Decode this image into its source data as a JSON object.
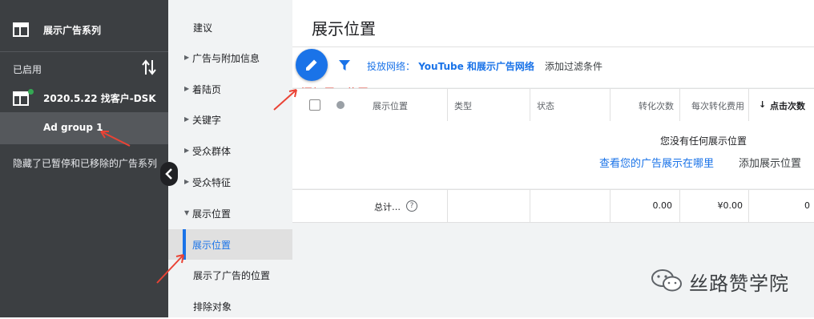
{
  "sidebar": {
    "campaign_types_label": "展示广告系列",
    "enabled_label": "已启用",
    "campaign_name": "2020.5.22 找客户-DSK",
    "ad_group_name": "Ad group 1",
    "hidden_note": "隐藏了已暂停和已移除的广告系列"
  },
  "nav": {
    "items": [
      {
        "label": "建议",
        "expandable": false
      },
      {
        "label": "广告与附加信息",
        "expandable": true
      },
      {
        "label": "着陆页",
        "expandable": true
      },
      {
        "label": "关键字",
        "expandable": true
      },
      {
        "label": "受众群体",
        "expandable": true
      },
      {
        "label": "受众特征",
        "expandable": true
      },
      {
        "label": "展示位置",
        "expandable": true,
        "expanded": true
      },
      {
        "label": "展示位置",
        "sub": true,
        "active": true
      },
      {
        "label": "展示了广告的位置",
        "sub": true
      },
      {
        "label": "排除对象",
        "sub": true
      }
    ]
  },
  "main": {
    "page_title": "展示位置",
    "toolbar": {
      "network_filter_key": "投放网络：",
      "network_filter_value": "YouTube 和展示广告网络",
      "add_filter": "添加过滤条件",
      "add_placement_annotation": "添加展示位置"
    },
    "table": {
      "columns": [
        "展示位置",
        "类型",
        "状态",
        "转化次数",
        "每次转化费用",
        "点击次数"
      ],
      "empty_message": "您没有任何展示位置",
      "empty_link": "查看您的广告展示在哪里",
      "empty_action": "添加展示位置",
      "total": {
        "label": "总计…",
        "conversions": "0.00",
        "cost_per_conv": "¥0.00",
        "clicks": "0"
      }
    }
  },
  "watermark": "丝路赞学院",
  "colors": {
    "accent": "#1a73e8",
    "sidebar": "#3c3f42",
    "annotation": "#ea4335"
  }
}
